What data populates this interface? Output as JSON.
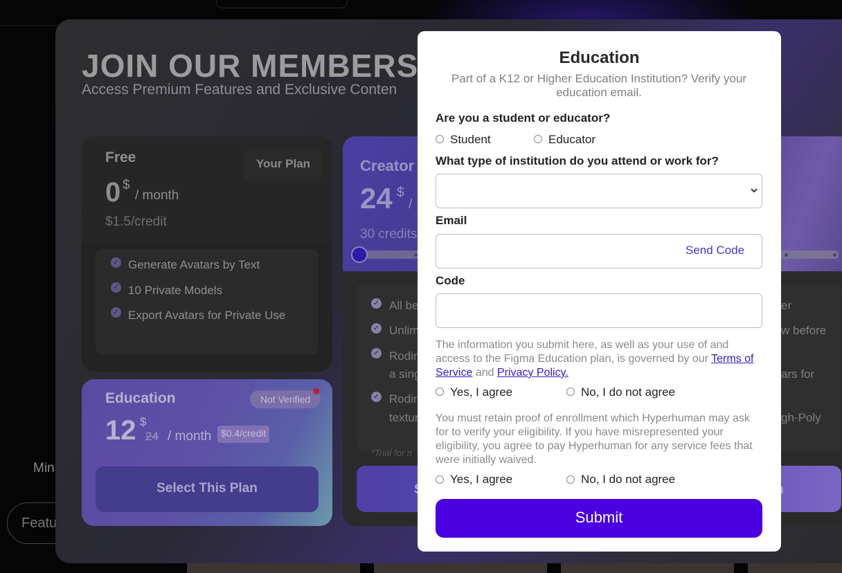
{
  "background": {
    "side_text": "Min",
    "side_pill": "Featu"
  },
  "membership": {
    "title": "JOIN OUR MEMBERSH",
    "subtitle": "Access Premium Features and Exclusive Conten",
    "free": {
      "name": "Free",
      "price": "0",
      "currency": "$",
      "unit": "/ month",
      "per_credit": "$1.5/credit",
      "badge": "Your Plan",
      "features": [
        "Generate Avatars by Text",
        "10 Private Models",
        "Export Avatars for Private Use"
      ]
    },
    "education": {
      "name": "Education",
      "status": "Not Verified",
      "price": "12",
      "currency": "$",
      "old_price": "24",
      "unit": "/ month",
      "per_credit": "$0.4/credit",
      "button": "Select This Plan"
    },
    "creator": {
      "name": "Creator",
      "price": "24",
      "currency": "$",
      "unit_partial": "/",
      "credits": "30 credits",
      "features_left": [
        "All be",
        "Unlim",
        "Rodin",
        "a sing",
        "Rodin",
        "textur"
      ],
      "features_right": [
        "er",
        "w before",
        "ars for",
        "gh-Poly"
      ],
      "trial": "*Trial for n",
      "button_left": "S",
      "button_right": "n"
    }
  },
  "modal": {
    "title": "Education",
    "description": "Part of a K12 or Higher Education Institution? Verify your education email.",
    "role_question": "Are you a student or educator?",
    "role_options": [
      "Student",
      "Educator"
    ],
    "institution_question": "What type of institution do you attend or work for?",
    "institution_value": "",
    "email_label": "Email",
    "email_value": "",
    "send_code": "Send Code",
    "code_label": "Code",
    "code_value": "",
    "info_1_text": "The information you submit here, as well as your use of and access to the Figma Education plan, is governed by our",
    "terms_link": "Terms of Service",
    "and_text": "and",
    "privacy_link": "Privacy Policy.",
    "agree_1": [
      "Yes, I agree",
      "No, I do not agree"
    ],
    "info_2_text": "You must retain proof of enrollment which Hyperhuman may ask for to verify your eligibility. If you have misrepresented your eligibility, you agree to pay Hyperhuman for any service fees that were initially waived.",
    "agree_2": [
      "Yes, I agree",
      "No, I do not agree"
    ],
    "submit": "Submit"
  },
  "colors": {
    "accent": "#4a00e0",
    "link": "#3a16c8",
    "status_dot": "#c0202a"
  }
}
